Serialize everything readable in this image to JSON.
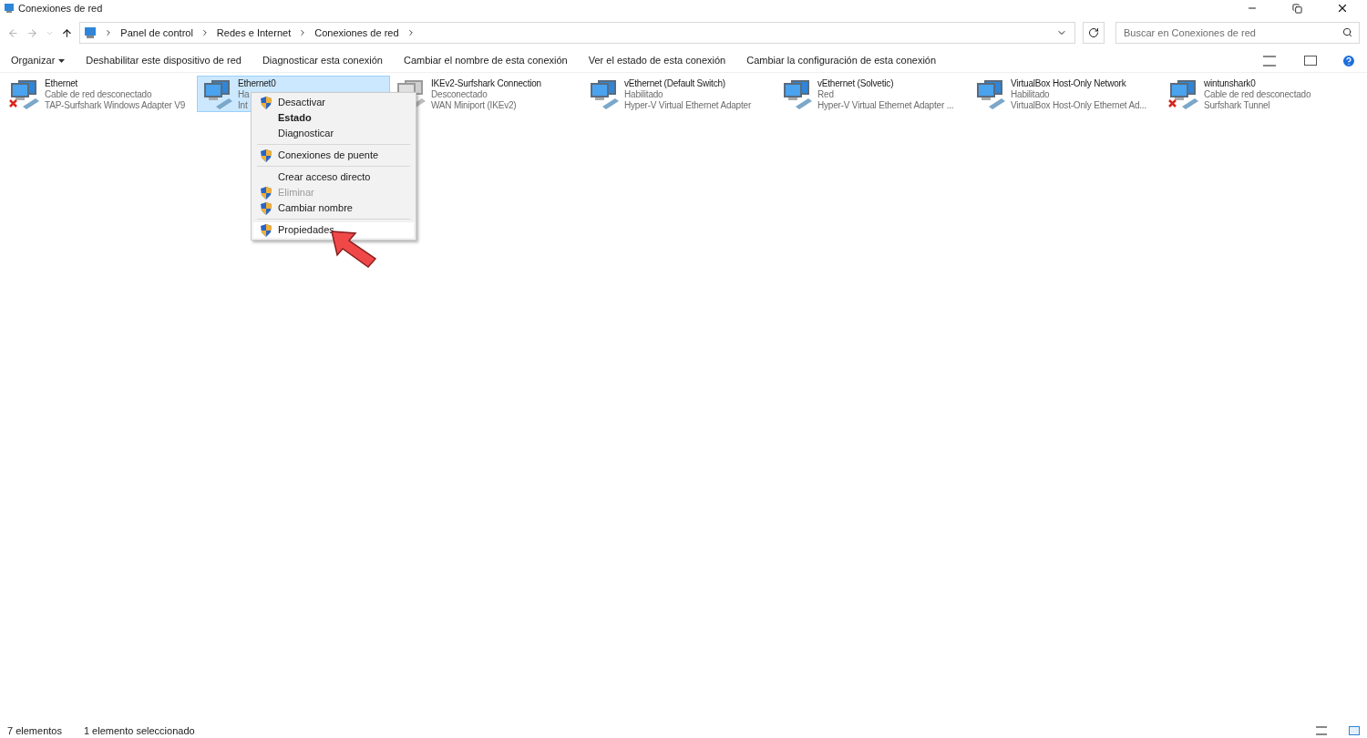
{
  "window": {
    "title": "Conexiones de red"
  },
  "address": {
    "breadcrumbs": [
      "Panel de control",
      "Redes e Internet",
      "Conexiones de red"
    ]
  },
  "search": {
    "placeholder": "Buscar en Conexiones de red"
  },
  "commands": [
    {
      "label": "Organizar",
      "dropdown": true
    },
    {
      "label": "Deshabilitar este dispositivo de red",
      "dropdown": false
    },
    {
      "label": "Diagnosticar esta conexión",
      "dropdown": false
    },
    {
      "label": "Cambiar el nombre de esta conexión",
      "dropdown": false
    },
    {
      "label": "Ver el estado de esta conexión",
      "dropdown": false
    },
    {
      "label": "Cambiar la configuración de esta conexión",
      "dropdown": false
    }
  ],
  "connections": [
    {
      "name": "Ethernet",
      "status": "Cable de red desconectado",
      "device": "TAP-Surfshark Windows Adapter V9",
      "kind": "disconnected",
      "selected": false
    },
    {
      "name": "Ethernet0",
      "status": "Ha",
      "device": "Int",
      "kind": "connected",
      "selected": true
    },
    {
      "name": "IKEv2-Surfshark Connection",
      "status": "Desconectado",
      "device": "WAN Miniport (IKEv2)",
      "kind": "greyed",
      "selected": false
    },
    {
      "name": "vEthernet (Default Switch)",
      "status": "Habilitado",
      "device": "Hyper-V Virtual Ethernet Adapter",
      "kind": "connected",
      "selected": false
    },
    {
      "name": "vEthernet (Solvetic)",
      "status": "Red",
      "device": "Hyper-V Virtual Ethernet Adapter ...",
      "kind": "connected",
      "selected": false
    },
    {
      "name": "VirtualBox Host-Only Network",
      "status": "Habilitado",
      "device": "VirtualBox Host-Only Ethernet Ad...",
      "kind": "connected",
      "selected": false
    },
    {
      "name": "wintunshark0",
      "status": "Cable de red desconectado",
      "device": "Surfshark Tunnel",
      "kind": "disconnected",
      "selected": false
    }
  ],
  "context_menu": [
    {
      "kind": "item",
      "label": "Desactivar",
      "shield": true,
      "bold": false,
      "disabled": false,
      "selected": false
    },
    {
      "kind": "item",
      "label": "Estado",
      "shield": false,
      "bold": true,
      "disabled": false,
      "selected": false
    },
    {
      "kind": "item",
      "label": "Diagnosticar",
      "shield": false,
      "bold": false,
      "disabled": false,
      "selected": false
    },
    {
      "kind": "separator"
    },
    {
      "kind": "item",
      "label": "Conexiones de puente",
      "shield": true,
      "bold": false,
      "disabled": false,
      "selected": false
    },
    {
      "kind": "separator"
    },
    {
      "kind": "item",
      "label": "Crear acceso directo",
      "shield": false,
      "bold": false,
      "disabled": false,
      "selected": false
    },
    {
      "kind": "item",
      "label": "Eliminar",
      "shield": true,
      "bold": false,
      "disabled": true,
      "selected": false
    },
    {
      "kind": "item",
      "label": "Cambiar nombre",
      "shield": true,
      "bold": false,
      "disabled": false,
      "selected": false
    },
    {
      "kind": "separator"
    },
    {
      "kind": "item",
      "label": "Propiedades",
      "shield": true,
      "bold": false,
      "disabled": false,
      "selected": true
    }
  ],
  "status_bar": {
    "count": "7 elementos",
    "selection": "1 elemento seleccionado"
  }
}
